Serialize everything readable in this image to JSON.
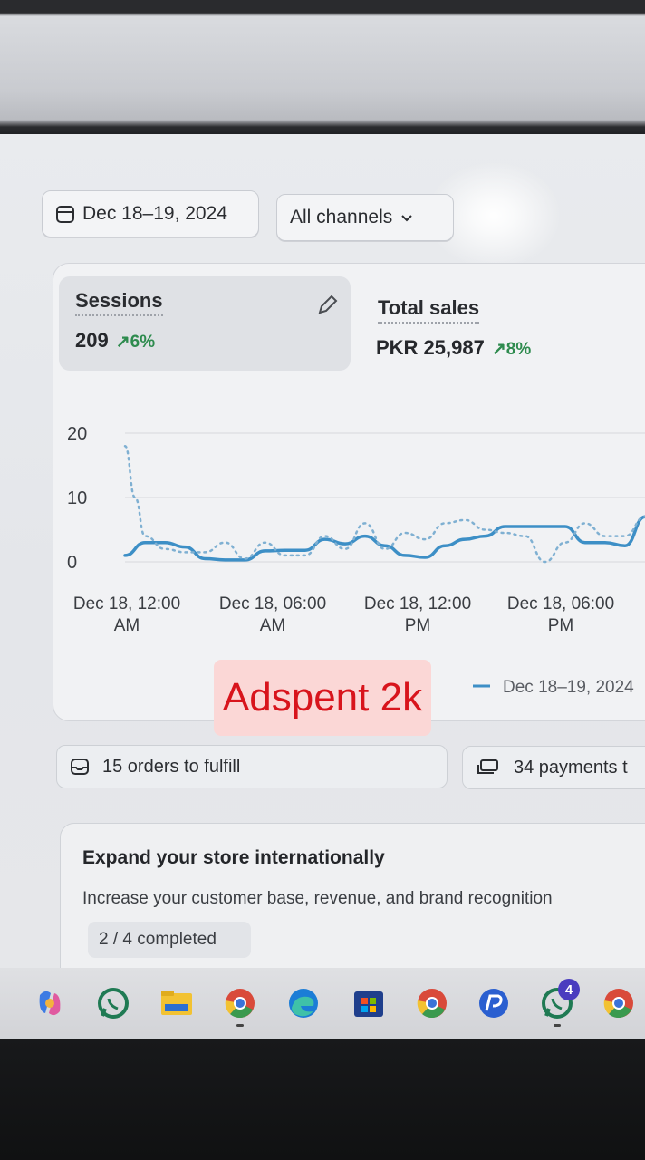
{
  "filters": {
    "date_range": "Dec 18–19, 2024",
    "channel": "All channels"
  },
  "metrics": {
    "sessions": {
      "label": "Sessions",
      "value": "209",
      "change": "6%"
    },
    "total_sales": {
      "label": "Total sales",
      "value": "PKR 25,987",
      "change": "8%"
    }
  },
  "chart_data": {
    "type": "line",
    "y_ticks": [
      "20",
      "10",
      "0"
    ],
    "ylim": [
      0,
      20
    ],
    "x_tick_labels": [
      {
        "line1": "Dec 18, 12:00",
        "line2": "AM"
      },
      {
        "line1": "Dec 18, 06:00",
        "line2": "AM"
      },
      {
        "line1": "Dec 18, 12:00",
        "line2": "PM"
      },
      {
        "line1": "Dec 18, 06:00",
        "line2": "PM"
      }
    ],
    "grid": true,
    "legend_label": "Dec 18–19, 2024",
    "legend_position": "bottom-right",
    "series": [
      {
        "name": "Dec 18–19, 2024",
        "style": "solid",
        "color": "#3d8fc6",
        "points": [
          [
            0,
            1
          ],
          [
            1,
            3
          ],
          [
            2,
            3
          ],
          [
            3,
            2.3
          ],
          [
            4,
            0.5
          ],
          [
            5,
            0.3
          ],
          [
            6,
            0.3
          ],
          [
            7,
            1.7
          ],
          [
            8,
            1.8
          ],
          [
            9,
            1.8
          ],
          [
            10,
            3.5
          ],
          [
            11,
            2.8
          ],
          [
            12,
            4
          ],
          [
            13,
            2.5
          ],
          [
            14,
            1
          ],
          [
            15,
            0.7
          ],
          [
            16,
            2.5
          ],
          [
            17,
            3.5
          ],
          [
            18,
            4
          ],
          [
            19,
            5.5
          ],
          [
            20,
            5.5
          ],
          [
            21,
            5.5
          ],
          [
            22,
            5.5
          ],
          [
            23,
            3
          ],
          [
            24,
            3
          ],
          [
            25,
            2.5
          ],
          [
            26,
            7
          ]
        ]
      },
      {
        "name": "",
        "style": "dotted",
        "color": "#7fb0d2",
        "points": [
          [
            0,
            18
          ],
          [
            0.5,
            10
          ],
          [
            1,
            4
          ],
          [
            2,
            2
          ],
          [
            3,
            1.5
          ],
          [
            4,
            1.5
          ],
          [
            5,
            3
          ],
          [
            6,
            0.5
          ],
          [
            7,
            3
          ],
          [
            8,
            1
          ],
          [
            9,
            1
          ],
          [
            10,
            4
          ],
          [
            11,
            2
          ],
          [
            12,
            6
          ],
          [
            13,
            2
          ],
          [
            14,
            4.5
          ],
          [
            15,
            3.5
          ],
          [
            16,
            6
          ],
          [
            17,
            6.5
          ],
          [
            18,
            5
          ],
          [
            19,
            4.5
          ],
          [
            20,
            4
          ],
          [
            21,
            0
          ],
          [
            22,
            3
          ],
          [
            23,
            6
          ],
          [
            24,
            4
          ],
          [
            25,
            4
          ],
          [
            26,
            7
          ]
        ]
      }
    ],
    "x_range": [
      0,
      26
    ]
  },
  "callout": {
    "text": "Adspent 2k"
  },
  "tasks": {
    "orders": "15 orders to fulfill",
    "payments": "34 payments t"
  },
  "expand_card": {
    "title": "Expand your store internationally",
    "subtitle": "Increase your customer base, revenue, and brand recognition",
    "progress": "2 / 4 completed"
  },
  "taskbar": {
    "icons": [
      "copilot-icon",
      "whatsapp-icon",
      "file-explorer-icon",
      "chrome-icon",
      "edge-icon",
      "store-icon",
      "chrome-icon",
      "app-icon",
      "whatsapp-icon",
      "chrome-icon"
    ],
    "whatsapp_badge": "4"
  }
}
